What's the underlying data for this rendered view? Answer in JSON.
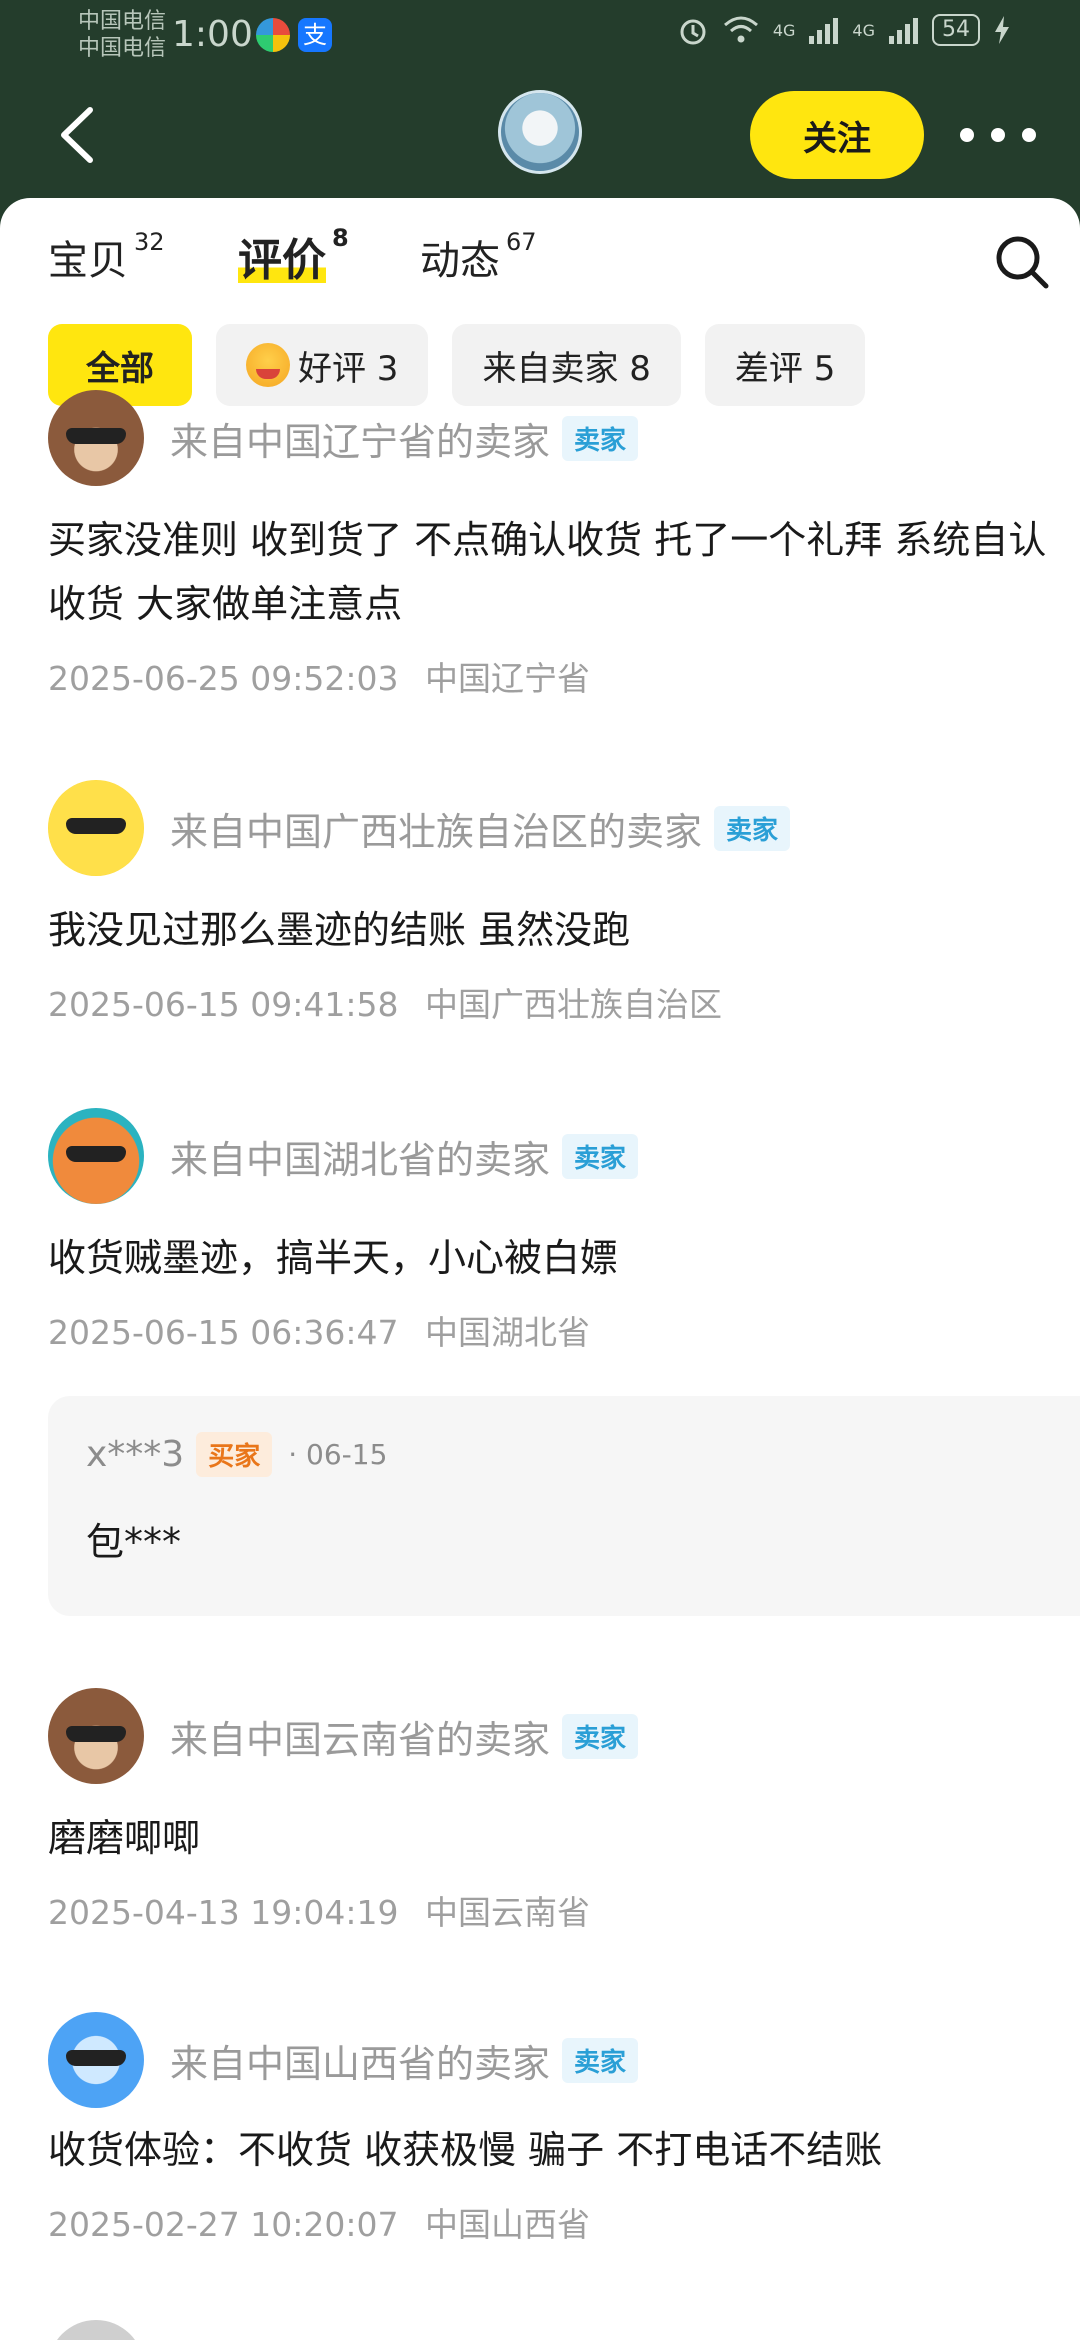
{
  "status_bar": {
    "carrier_1": "中国电信",
    "carrier_2": "中国电信",
    "time": "1:00",
    "network_1": "4G",
    "network_2": "4G",
    "battery": "54"
  },
  "header": {
    "follow_label": "关注"
  },
  "tabs": [
    {
      "label": "宝贝",
      "count": "32",
      "active": false
    },
    {
      "label": "评价",
      "count": "8",
      "active": true
    },
    {
      "label": "动态",
      "count": "67",
      "active": false
    }
  ],
  "filters": [
    {
      "label": "全部",
      "active": true
    },
    {
      "label": "好评 3",
      "icon": "smile-emoji-icon",
      "active": false
    },
    {
      "label": "来自卖家 8",
      "active": false
    },
    {
      "label": "差评 5",
      "active": false
    }
  ],
  "reviews": [
    {
      "reviewer": "来自中国辽宁省的卖家",
      "tag": "卖家",
      "text": "买家没准则 收到货了 不点确认收货 托了一个礼拜 系统自认收货 大家做单注意点",
      "datetime": "2025-06-25 09:52:03",
      "location": "中国辽宁省"
    },
    {
      "reviewer": "来自中国广西壮族自治区的卖家",
      "tag": "卖家",
      "text": "我没见过那么墨迹的结账 虽然没跑",
      "datetime": "2025-06-15 09:41:58",
      "location": "中国广西壮族自治区"
    },
    {
      "reviewer": "来自中国湖北省的卖家",
      "tag": "卖家",
      "text": "收货贼墨迹，搞半天，小心被白嫖",
      "datetime": "2025-06-15 06:36:47",
      "location": "中国湖北省"
    },
    {
      "reviewer": "来自中国云南省的卖家",
      "tag": "卖家",
      "text": "磨磨唧唧",
      "datetime": "2025-04-13 19:04:19",
      "location": "中国云南省"
    },
    {
      "reviewer": "来自中国山西省的卖家",
      "tag": "卖家",
      "text": "收货体验：不收货 收获极慢 骗子 不打电话不结账",
      "datetime": "2025-02-27 10:20:07",
      "location": "中国山西省"
    }
  ],
  "reply": {
    "user": "x***3",
    "tag": "买家",
    "date": "· 06-15",
    "text": "包***"
  },
  "colors": {
    "header_bg": "#243d2c",
    "accent_yellow": "#ffe60f",
    "seller_tag": "#2a9fd6",
    "buyer_tag": "#e9761a"
  }
}
